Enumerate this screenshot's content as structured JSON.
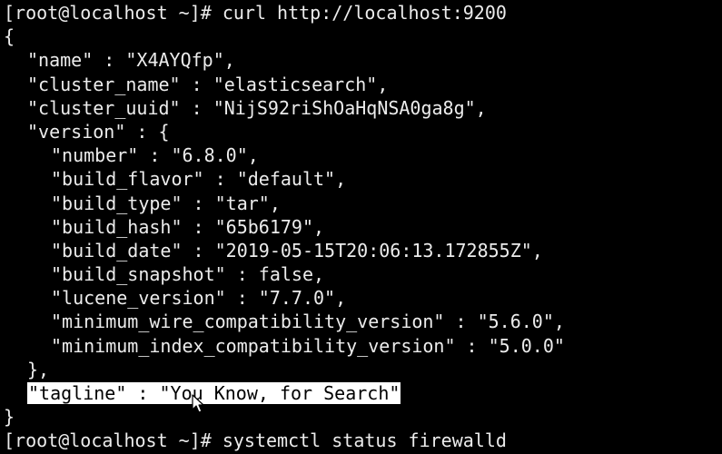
{
  "terminal": {
    "prompt_1": "[root@localhost ~]# ",
    "command_1": "curl http://localhost:9200",
    "open_brace": "{",
    "name": "\"name\" : \"X4AYQfp\",",
    "cluster_name": "\"cluster_name\" : \"elasticsearch\",",
    "cluster_uuid": "\"cluster_uuid\" : \"NijS92riShOaHqNSA0ga8g\",",
    "version_open": "\"version\" : {",
    "version": {
      "number": "\"number\" : \"6.8.0\",",
      "build_flavor": "\"build_flavor\" : \"default\",",
      "build_type": "\"build_type\" : \"tar\",",
      "build_hash": "\"build_hash\" : \"65b6179\",",
      "build_date": "\"build_date\" : \"2019-05-15T20:06:13.172855Z\",",
      "build_snapshot": "\"build_snapshot\" : false,",
      "lucene_version": "\"lucene_version\" : \"7.7.0\",",
      "minimum_wire_compatibility_version": "\"minimum_wire_compatibility_version\" : \"5.6.0\",",
      "minimum_index_compatibility_version": "\"minimum_index_compatibility_version\" : \"5.0.0\""
    },
    "version_close": "},",
    "tagline": "\"tagline\" : \"You Know, for Search\"",
    "close_brace": "}",
    "prompt_2": "[root@localhost ~]# ",
    "command_2": "systemctl status firewalld"
  },
  "colors": {
    "background": "#000000",
    "text": "#ececec",
    "selection_bg": "#ffffff",
    "selection_text": "#000000"
  },
  "icons": {
    "cursor": "mouse-pointer-icon"
  }
}
